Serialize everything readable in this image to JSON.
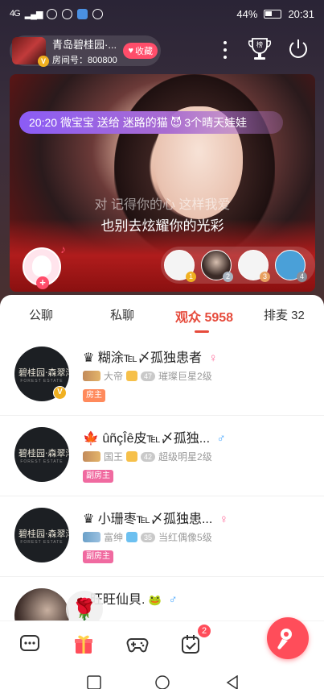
{
  "status_bar": {
    "network": "4G",
    "battery": "44%",
    "time": "20:31"
  },
  "room": {
    "title": "青岛碧桂园·...",
    "room_id": "房间号：800800",
    "fav_label": "收藏",
    "thumb_badge": "V"
  },
  "video": {
    "gift_banner": {
      "time": "20:20",
      "sender": "微宝宝",
      "action": "送给",
      "receiver": "迷路的猫",
      "emoji": "😈",
      "tail": "3个晴天娃娃"
    },
    "lyric_prev": "对 记得你的心 这样我爱",
    "lyric_current": "也别去炫耀你的光彩"
  },
  "seats": [
    {
      "badge": "1",
      "badge_color": "#f0b020"
    },
    {
      "badge": "2",
      "badge_color": "#aab4c0"
    },
    {
      "badge": "3",
      "badge_color": "#e8a060"
    },
    {
      "badge": "4",
      "badge_color": "#8a8f99"
    }
  ],
  "tabs": [
    {
      "label": "公聊",
      "active": false
    },
    {
      "label": "私聊",
      "active": false
    },
    {
      "label": "观众 5958",
      "active": true
    },
    {
      "label": "排麦 32",
      "active": false
    }
  ],
  "viewers": [
    {
      "prefix": "♛",
      "name": "糊涂℡〆孤独患者",
      "gender": "♀",
      "rank_label": "大帝",
      "level_num": "47",
      "level_label": "璀璨巨星2级",
      "role": "房主",
      "avatar_text": "碧桂园·森翠湾",
      "avatar_sub": "FOREST ESTATE",
      "has_v": true
    },
    {
      "prefix": "🍁",
      "name": "ûñçÎê皮℡〆孤独...",
      "gender": "♂",
      "rank_label": "国王",
      "level_num": "42",
      "level_label": "超级明星2级",
      "role": "副房主",
      "avatar_text": "碧桂园·森翠湾",
      "avatar_sub": "FOREST ESTATE",
      "has_v": false
    },
    {
      "prefix": "♛",
      "name": "小珊枣℡〆孤独患...",
      "gender": "♀",
      "rank_label": "富绅",
      "level_num": "35",
      "level_label": "当红偶像5级",
      "role": "副房主",
      "avatar_text": "碧桂园·森翠湾",
      "avatar_sub": "FOREST ESTATE",
      "has_v": false
    },
    {
      "prefix": "",
      "name": "旺旺仙貝.",
      "gender": "♂",
      "rank_label": "",
      "level_num": "",
      "level_label": "",
      "role": "",
      "avatar_text": "",
      "avatar_sub": "",
      "has_v": false
    }
  ],
  "toolbar": {
    "task_badge": "2"
  },
  "colors": {
    "accent": "#e64b3c",
    "fav_pink": "#ff4d6a",
    "mic_red": "#ff4d5a",
    "banner_purple": "#8b5cf6"
  },
  "icons": [
    "chat-icon",
    "gift-icon",
    "gamepad-icon",
    "task-icon",
    "microphone-icon",
    "more-icon",
    "ranking-icon",
    "power-icon",
    "rose-icon"
  ]
}
